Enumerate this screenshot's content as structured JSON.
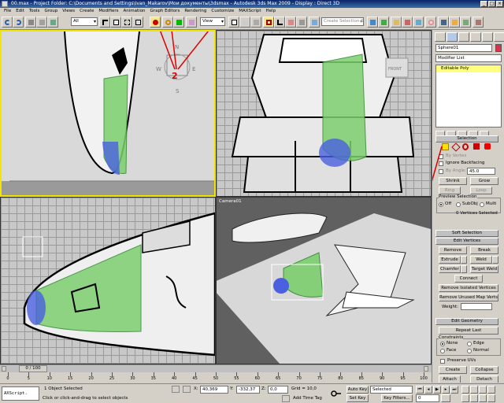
{
  "window": {
    "title": "00.max - Project Folder: C:\\Documents and Settings\\Ivan_Makarov\\Мои документы\\3dsmax - Autodesk 3ds Max 2009 - Display : Direct 3D",
    "min": "_",
    "max": "□",
    "close": "×"
  },
  "menu": [
    "File",
    "Edit",
    "Tools",
    "Group",
    "Views",
    "Create",
    "Modifiers",
    "Animation",
    "Graph Editors",
    "Rendering",
    "Customize",
    "MAXScript",
    "Help"
  ],
  "toolbar": {
    "selection_filter": "All",
    "reference_coord": "View",
    "named_selection": "Create Selection Set"
  },
  "viewports": {
    "top_left_label": "",
    "top_right_label": "",
    "front_cube_label": "FRONT",
    "bottom_right_label": "Camera01",
    "compass": {
      "n": "N",
      "w": "W",
      "e": "E",
      "s": "S"
    }
  },
  "annotations": {
    "one": "1",
    "two": "2"
  },
  "command_panel": {
    "object_name": "Sphere01",
    "modifier_list": "Modifier List",
    "stack_item": "Editable Poly",
    "selection_rollout": "Selection",
    "by_vertex": "By Vertex",
    "ignore_backfacing": "Ignore Backfacing",
    "by_angle": "By Angle:",
    "by_angle_value": "45.0",
    "shrink": "Shrink",
    "grow": "Grow",
    "ring": "Ring",
    "loop": "Loop",
    "preview_selection": "Preview Selection",
    "off": "Off",
    "subobj": "SubObj",
    "multi": "Multi",
    "selected_info": "0 Vertices Selected",
    "soft_selection": "Soft Selection",
    "edit_vertices": "Edit Vertices",
    "remove": "Remove",
    "break": "Break",
    "extrude": "Extrude",
    "weld": "Weld",
    "chamfer": "Chamfer",
    "target_weld": "Target Weld",
    "connect": "Connect",
    "remove_isolated": "Remove Isolated Vertices",
    "remove_unused": "Remove Unused Map Verts",
    "weight": "Weight:",
    "edit_geometry": "Edit Geometry",
    "repeat_last": "Repeat Last",
    "constraints": "Constraints",
    "none": "None",
    "edge": "Edge",
    "face": "Face",
    "normal": "Normal",
    "preserve_uvs": "Preserve UVs",
    "create": "Create",
    "collapse": "Collapse",
    "attach": "Attach",
    "detach": "Detach"
  },
  "timeline": {
    "frame": "0 / 100",
    "ticks": [
      "0",
      "5",
      "10",
      "15",
      "20",
      "25",
      "30",
      "35",
      "40",
      "45",
      "50",
      "55",
      "60",
      "65",
      "70",
      "75",
      "80",
      "85",
      "90",
      "95",
      "100"
    ]
  },
  "status": {
    "maxscript": "AXScript.",
    "objects_selected": "1 Object Selected",
    "prompt": "Click or click-and-drag to select objects",
    "x_label": "X:",
    "x_value": "40,369",
    "y_label": "Y:",
    "y_value": "-332,37",
    "z_label": "Z:",
    "z_value": "0,0",
    "grid": "Grid = 10,0",
    "add_time_tag": "Add Time Tag",
    "auto_key": "Auto Key",
    "selected": "Selected",
    "set_key": "Set Key",
    "key_filters": "Key Filters...",
    "frame_field": "0"
  }
}
